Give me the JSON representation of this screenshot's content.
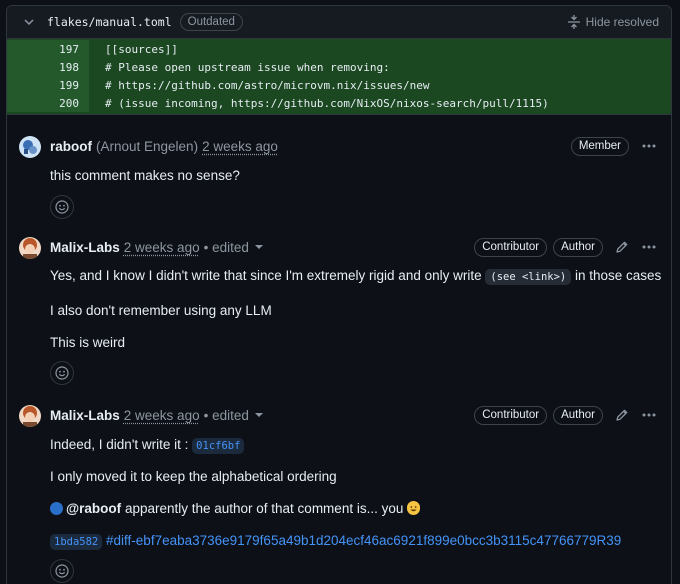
{
  "file": {
    "name": "flakes/manual.toml",
    "status_badge": "Outdated",
    "hide_resolved_label": "Hide resolved"
  },
  "diff_lines": [
    {
      "num": "197",
      "code": "[[sources]]"
    },
    {
      "num": "198",
      "code": "# Please open upstream issue when removing:"
    },
    {
      "num": "199",
      "code": "# https://github.com/astro/microvm.nix/issues/new"
    },
    {
      "num": "200",
      "code": "# (issue incoming, https://github.com/NixOS/nixos-search/pull/1115)"
    }
  ],
  "comments": [
    {
      "author": "raboof",
      "full_name": "(Arnout Engelen)",
      "time": "2 weeks ago",
      "badges": [
        "Member"
      ],
      "paragraphs": [
        "this comment makes no sense?"
      ]
    },
    {
      "author": "Malix-Labs",
      "time": "2 weeks ago",
      "edited": "• edited",
      "badges": [
        "Contributor",
        "Author"
      ],
      "p1_before": "Yes, and I know I didn't write that since I'm extremely rigid and only write",
      "p1_code": "(see <link>)",
      "p1_after": "in those cases",
      "p2": "I also don't remember using any LLM",
      "p3": "This is weird"
    },
    {
      "author": "Malix-Labs",
      "time": "2 weeks ago",
      "edited": "• edited",
      "badges": [
        "Contributor",
        "Author"
      ],
      "p1_before": "Indeed, I didn't write it :",
      "p1_sha": "01cf6bf",
      "p2": "I only moved it to keep the alphabetical ordering",
      "p3_mention": "@raboof",
      "p3_after": "apparently the author of that comment is... you",
      "p4_sha": "1bda582",
      "p4_link": "#diff-ebf7eaba3736e9179f65a49b1d204ecf46ac6921f899e0bcc3b3115c47766779R39"
    }
  ],
  "colors": {
    "background": "#0d1117",
    "diff_added": "#1b4721",
    "link": "#4493f8",
    "muted": "#8d96a0"
  },
  "icons": {
    "collapse": "chevron-down-icon",
    "hide_resolved": "fold-icon",
    "more": "kebab-horizontal-icon",
    "edit": "pencil-icon",
    "reaction": "smiley-icon"
  }
}
